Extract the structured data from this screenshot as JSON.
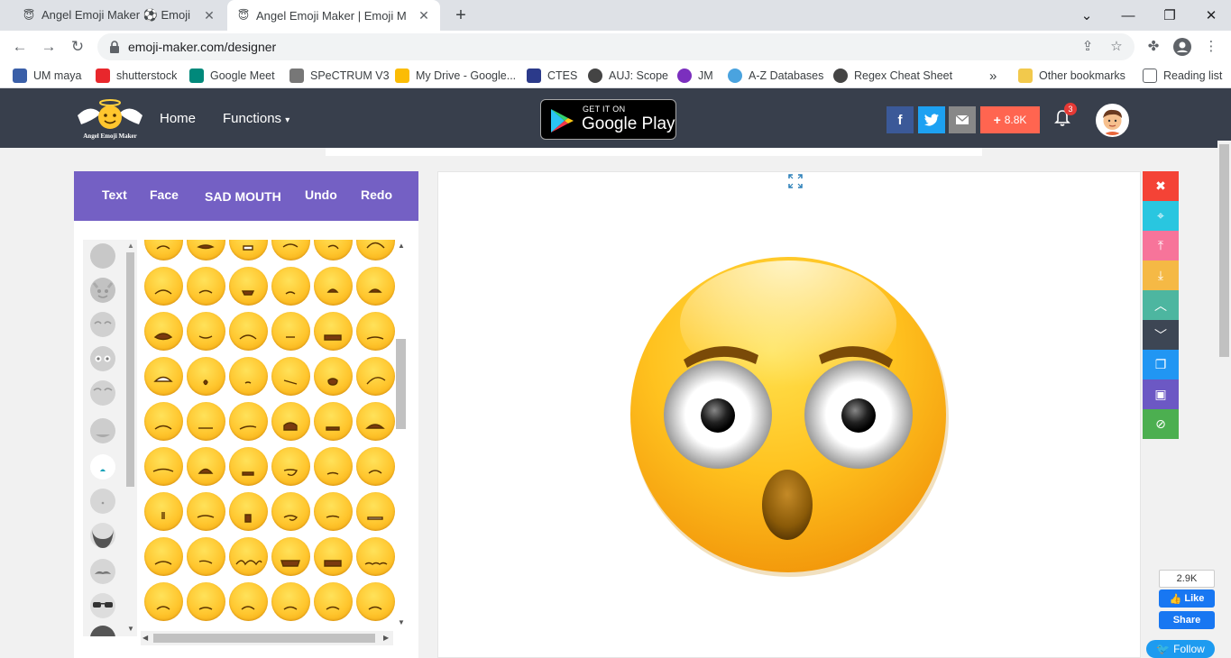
{
  "browser": {
    "tabs": [
      {
        "title": "Angel Emoji Maker ⚽ Emoji",
        "active": false
      },
      {
        "title": "Angel Emoji Maker | Emoji M",
        "active": true
      }
    ],
    "url": "emoji-maker.com/designer",
    "bookmarks": [
      {
        "label": "UM maya",
        "color": "#3a5fa8"
      },
      {
        "label": "shutterstock",
        "color": "#e8272c"
      },
      {
        "label": "Google Meet",
        "color": "#00897b"
      },
      {
        "label": "SPeCTRUM V3",
        "color": "#777777"
      },
      {
        "label": "My Drive - Google...",
        "color": "#fbbc04"
      },
      {
        "label": "CTES",
        "color": "#2b3a8a"
      },
      {
        "label": "AUJ: Scope",
        "color": "#444444"
      },
      {
        "label": "JM",
        "color": "#7b2fbe"
      },
      {
        "label": "A-Z Databases",
        "color": "#4aa3df"
      },
      {
        "label": "Regex Cheat Sheet",
        "color": "#444444"
      }
    ],
    "other_bookmarks": "Other bookmarks",
    "reading_list": "Reading list"
  },
  "site": {
    "nav": {
      "home": "Home",
      "functions": "Functions"
    },
    "google_play": {
      "line1": "GET IT ON",
      "line2": "Google Play"
    },
    "share_count": "8.8K",
    "notifications": "3"
  },
  "editor": {
    "toolbar": {
      "text": "Text",
      "face": "Face",
      "category": "SAD MOUTH",
      "undo": "Undo",
      "redo": "Redo"
    },
    "side_categories": [
      "face",
      "devil",
      "eyes-closed",
      "eyes",
      "brows",
      "mouth",
      "teal-drop",
      "small-dot",
      "beard",
      "mustache",
      "sunglasses",
      "hair"
    ],
    "mouth_rows": 9,
    "mouth_cols": 6
  },
  "right_tools": [
    {
      "icon": "close-icon",
      "color": "#f44336",
      "glyph": "✖"
    },
    {
      "icon": "center-focus-icon",
      "color": "#29c6e0",
      "glyph": "⌖"
    },
    {
      "icon": "bring-to-top-icon",
      "color": "#f7749a",
      "glyph": "⤒"
    },
    {
      "icon": "send-to-bottom-icon",
      "color": "#f5b945",
      "glyph": "⤓"
    },
    {
      "icon": "move-up-icon",
      "color": "#4db6a0",
      "glyph": "︿"
    },
    {
      "icon": "move-down-icon",
      "color": "#3d4654",
      "glyph": "﹀"
    },
    {
      "icon": "copy-icon",
      "color": "#2196f3",
      "glyph": "❐"
    },
    {
      "icon": "paste-icon",
      "color": "#6c58c4",
      "glyph": "▣"
    },
    {
      "icon": "hide-icon",
      "color": "#4caf50",
      "glyph": "⊘"
    }
  ],
  "social_widget": {
    "like_count": "2.9K",
    "like": "Like",
    "share": "Share",
    "follow": "Follow"
  }
}
